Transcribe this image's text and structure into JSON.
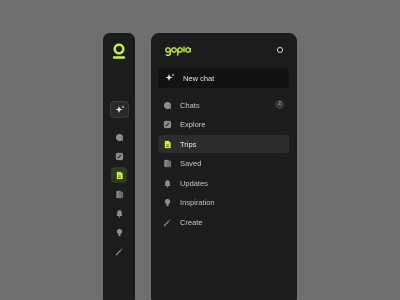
{
  "colors": {
    "background": "#6f6f6f",
    "sidebar": "#1c1c1c",
    "accent": "#c9f23a",
    "text": "#c8c8c8",
    "active_bg": "#2c2c2c"
  },
  "rail": {
    "logo": "logo-mark",
    "new_chat_icon": "sparkle-icon",
    "icons": [
      "chat-icon",
      "compass-icon",
      "trips-icon",
      "saved-icon",
      "bell-icon",
      "bulb-icon",
      "magic-wand-icon"
    ],
    "active_index": 2
  },
  "panel": {
    "brand": "gopla",
    "new_chat_label": "New chat",
    "items": [
      {
        "label": "Chats",
        "icon": "chat-icon",
        "badge": "2"
      },
      {
        "label": "Explore",
        "icon": "compass-icon"
      },
      {
        "label": "Trips",
        "icon": "trips-icon",
        "active": true
      },
      {
        "label": "Saved",
        "icon": "saved-icon"
      },
      {
        "label": "Updates",
        "icon": "bell-icon"
      },
      {
        "label": "Inspiration",
        "icon": "bulb-icon"
      },
      {
        "label": "Create",
        "icon": "magic-wand-icon"
      }
    ]
  }
}
